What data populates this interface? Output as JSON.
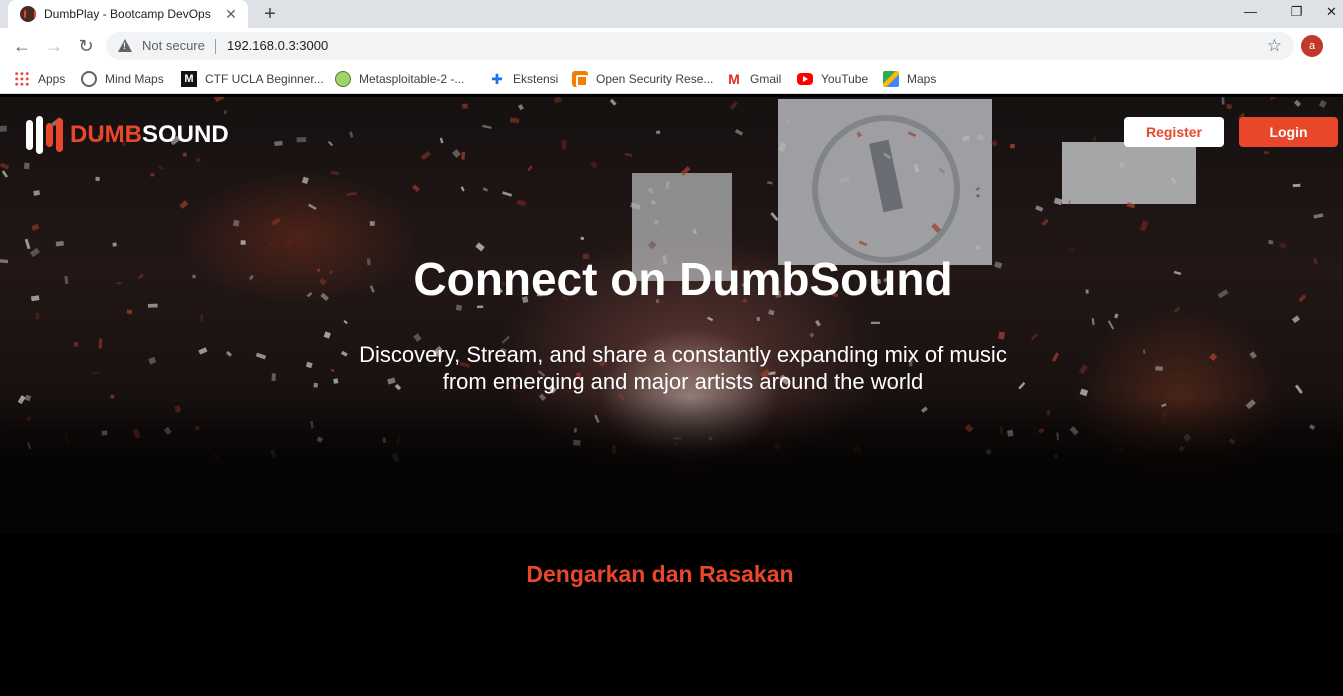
{
  "browser": {
    "tab_title": "DumbPlay - Bootcamp DevOps",
    "security_label": "Not secure",
    "url": "192.168.0.3:3000",
    "profile_initial": "a",
    "bookmarks": [
      {
        "label": "Apps",
        "icon": "apps-grid-icon"
      },
      {
        "label": "Mind Maps",
        "icon": "globe-icon"
      },
      {
        "label": "CTF UCLA Beginner...",
        "icon": "medium-icon"
      },
      {
        "label": "Metasploitable-2 -...",
        "icon": "metasploit-icon"
      },
      {
        "label": "Ekstensi",
        "icon": "puzzle-icon"
      },
      {
        "label": "Open Security Rese...",
        "icon": "blogger-icon"
      },
      {
        "label": "Gmail",
        "icon": "gmail-icon"
      },
      {
        "label": "YouTube",
        "icon": "youtube-icon"
      },
      {
        "label": "Maps",
        "icon": "maps-icon"
      }
    ]
  },
  "site": {
    "logo": {
      "part1": "DUMB",
      "part2": "SOUND"
    },
    "nav": {
      "register_label": "Register",
      "login_label": "Login"
    },
    "hero": {
      "title": "Connect on DumbSound",
      "subtitle_line1": "Discovery, Stream, and share a constantly expanding mix of music",
      "subtitle_line2": "from emerging and major artists around the world"
    },
    "section_title": "Dengarkan dan Rasakan"
  },
  "colors": {
    "brand_accent": "#e8472a",
    "page_background": "#000000",
    "chrome_tabbar": "#dee1e6"
  }
}
